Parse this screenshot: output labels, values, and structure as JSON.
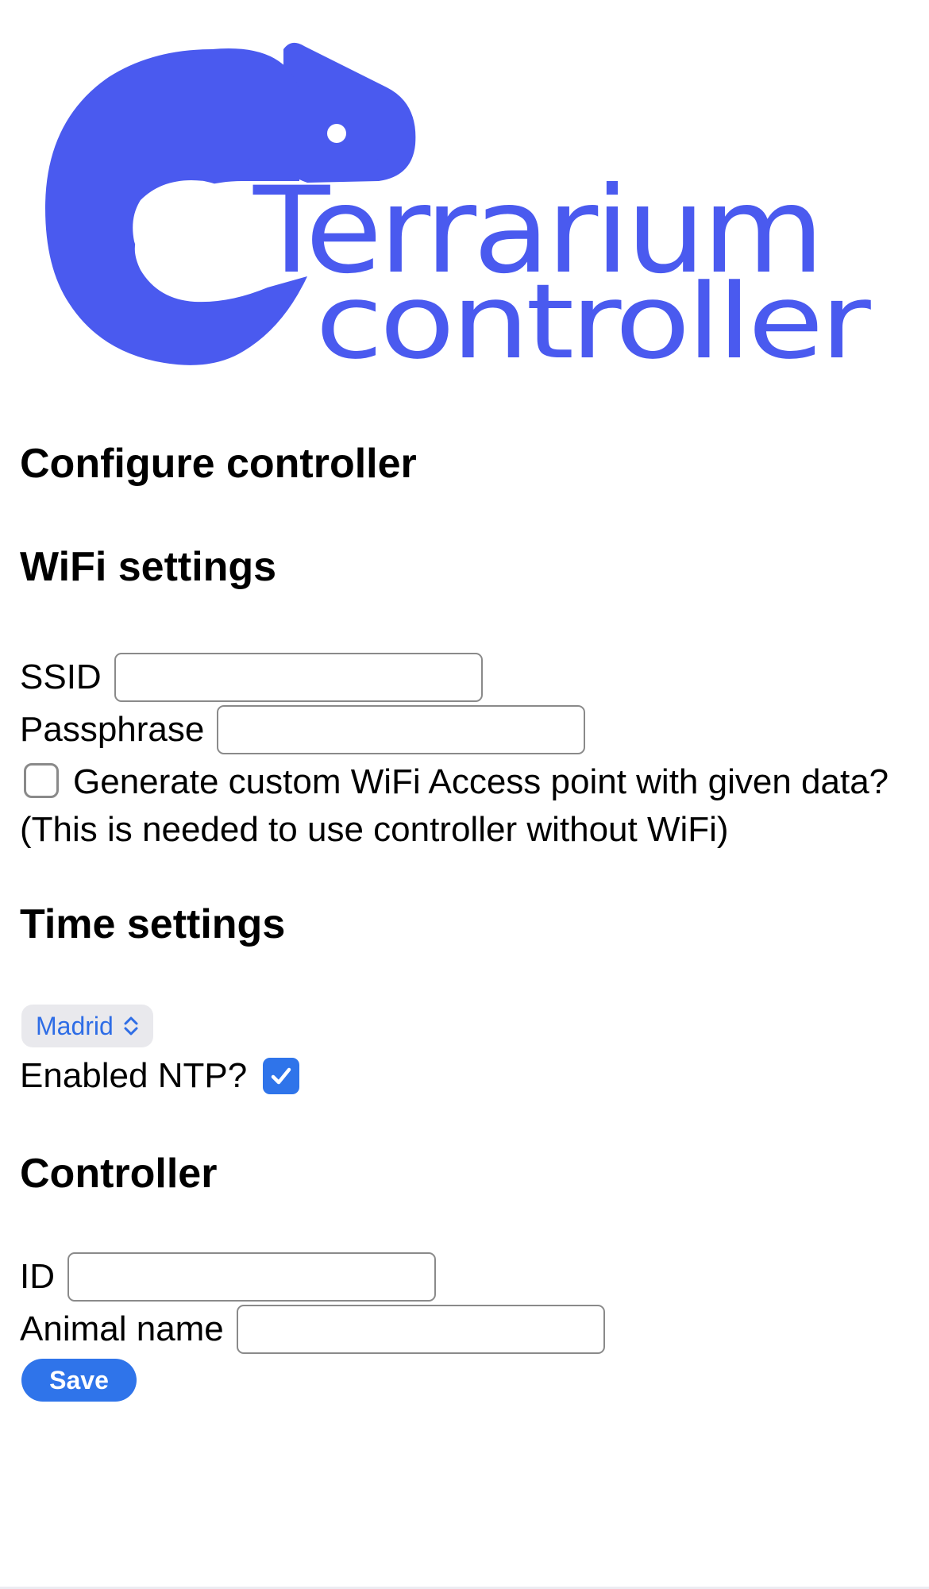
{
  "logo": {
    "line1": "Terrarium",
    "line2": "controller",
    "color": "#4a5aef",
    "icon": "chameleon-icon"
  },
  "page_title": "Configure controller",
  "wifi": {
    "heading": "WiFi settings",
    "ssid_label": "SSID",
    "ssid_value": "",
    "passphrase_label": "Passphrase",
    "passphrase_value": "",
    "custom_ap_checked": false,
    "custom_ap_label": "Generate custom WiFi Access point with given data? (This is needed to use controller without WiFi)"
  },
  "time": {
    "heading": "Time settings",
    "timezone_selected": "Madrid",
    "ntp_label": "Enabled NTP?",
    "ntp_checked": true
  },
  "controller": {
    "heading": "Controller",
    "id_label": "ID",
    "id_value": "",
    "animal_label": "Animal name",
    "animal_value": "",
    "save_label": "Save"
  },
  "colors": {
    "accent": "#2f74ea",
    "select_text": "#2e6de6",
    "select_bg": "#e9e9ed"
  }
}
